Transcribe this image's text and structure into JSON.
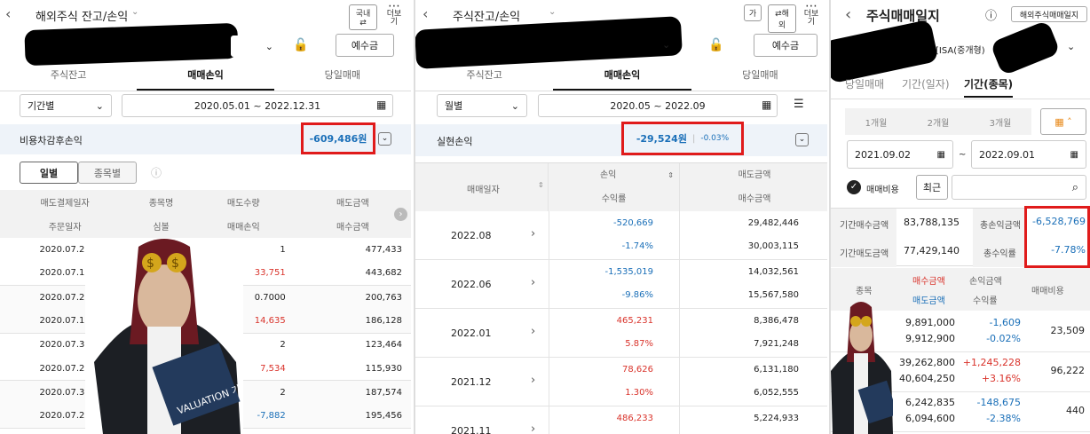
{
  "panel1": {
    "title": "해외주식 잔고/손익",
    "toggle_label": "국내",
    "more_label": "더보기",
    "deposit_button": "예수금",
    "tabs": [
      "주식잔고",
      "매매손익",
      "당일매매"
    ],
    "period_select": "기간별",
    "date_range": "2020.05.01 ~ 2022.12.31",
    "summary_label": "비용차감후손익",
    "summary_value": "-609,486원",
    "view_tabs": [
      "일별",
      "종목별"
    ],
    "headers_top": [
      "매도결제일자",
      "종목명",
      "매도수량",
      "매도금액"
    ],
    "headers_bottom": [
      "주문일자",
      "심볼",
      "매매손익",
      "매수금액"
    ],
    "rows": [
      {
        "date": "2020.07.20",
        "qty": "1",
        "amount": "477,433",
        "color": "normal"
      },
      {
        "date": "2020.07.15",
        "qty": "33,751",
        "amount": "443,682",
        "color": "red"
      },
      {
        "date": "2020.07.21",
        "qty": "0.7000",
        "amount": "200,763",
        "color": "normal"
      },
      {
        "date": "2020.07.16",
        "qty": "14,635",
        "amount": "186,128",
        "color": "red"
      },
      {
        "date": "2020.07.30",
        "qty": "2",
        "amount": "123,464",
        "color": "normal"
      },
      {
        "date": "2020.07.27",
        "qty": "7,534",
        "amount": "115,930",
        "color": "red"
      },
      {
        "date": "2020.07.30",
        "qty": "2",
        "amount": "187,574",
        "color": "normal"
      },
      {
        "date": "2020.07.27",
        "qty": "-7,882",
        "amount": "195,456",
        "color": "blue"
      }
    ]
  },
  "panel2": {
    "title": "주식잔고/손익",
    "font_button": "가",
    "overseas_button": "해외",
    "more_label": "더보기",
    "deposit_button": "예수금",
    "tabs": [
      "주식잔고",
      "매매손익",
      "당일매매"
    ],
    "period_select": "월별",
    "date_range": "2020.05 ~ 2022.09",
    "summary_label": "실현손익",
    "summary_value": "-29,524원",
    "summary_rate": "-0.03%",
    "headers": {
      "date": "매매일자",
      "pl": "손익",
      "rate": "수익률",
      "sell": "매도금액",
      "buy": "매수금액"
    },
    "rows": [
      {
        "month": "2022.08",
        "pl": "-520,669",
        "rate": "-1.74%",
        "sell": "29,482,446",
        "buy": "30,003,115",
        "color": "blue"
      },
      {
        "month": "2022.06",
        "pl": "-1,535,019",
        "rate": "-9.86%",
        "sell": "14,032,561",
        "buy": "15,567,580",
        "color": "blue"
      },
      {
        "month": "2022.01",
        "pl": "465,231",
        "rate": "5.87%",
        "sell": "8,386,478",
        "buy": "7,921,248",
        "color": "red"
      },
      {
        "month": "2021.12",
        "pl": "78,626",
        "rate": "1.30%",
        "sell": "6,131,180",
        "buy": "6,052,555",
        "color": "red"
      },
      {
        "month": "2021.11",
        "pl": "486,233",
        "rate": "",
        "sell": "5,224,933",
        "buy": "",
        "color": "red"
      }
    ]
  },
  "panel3": {
    "title": "주식매매일지",
    "journal_button": "해외주식매매일지",
    "account_suffix": "[ISA(중개형)",
    "tabs": [
      "당일매매",
      "기간(일자)",
      "기간(종목)"
    ],
    "quick_periods": [
      "1개월",
      "2개월",
      "3개월"
    ],
    "start_date": "2021.09.02",
    "tilde": "~",
    "end_date": "2022.09.01",
    "fee_checkbox": "매매비용",
    "recent_button": "최근",
    "stats": {
      "buy_label": "기간매수금액",
      "buy_value": "83,788,135",
      "sell_label": "기간매도금액",
      "sell_value": "77,429,140",
      "pl_label": "총손익금액",
      "pl_value": "-6,528,769",
      "rate_label": "총수익률",
      "rate_value": "-7.78%"
    },
    "headers": {
      "stock": "종목",
      "buy": "매수금액",
      "sell": "매도금액",
      "pl": "손익금액",
      "rate": "수익률",
      "fee": "매매비용"
    },
    "rows": [
      {
        "buy": "9,891,000",
        "sell": "9,912,900",
        "pl": "-1,609",
        "rate": "-0.02%",
        "fee": "23,509",
        "color": "blue"
      },
      {
        "buy": "39,262,800",
        "sell": "40,604,250",
        "pl": "+1,245,228",
        "rate": "+3.16%",
        "fee": "96,222",
        "color": "red"
      },
      {
        "buy": "6,242,835",
        "sell": "6,094,600",
        "pl": "-148,675",
        "rate": "-2.38%",
        "fee": "440",
        "color": "blue"
      }
    ]
  },
  "photo": {
    "book_text": "VALUATION 기업가치"
  },
  "colors": {
    "blue": "#1a6fb8",
    "red": "#d9332b",
    "highlight": "#e01b1b",
    "summary_bg": "#eef3f9"
  }
}
